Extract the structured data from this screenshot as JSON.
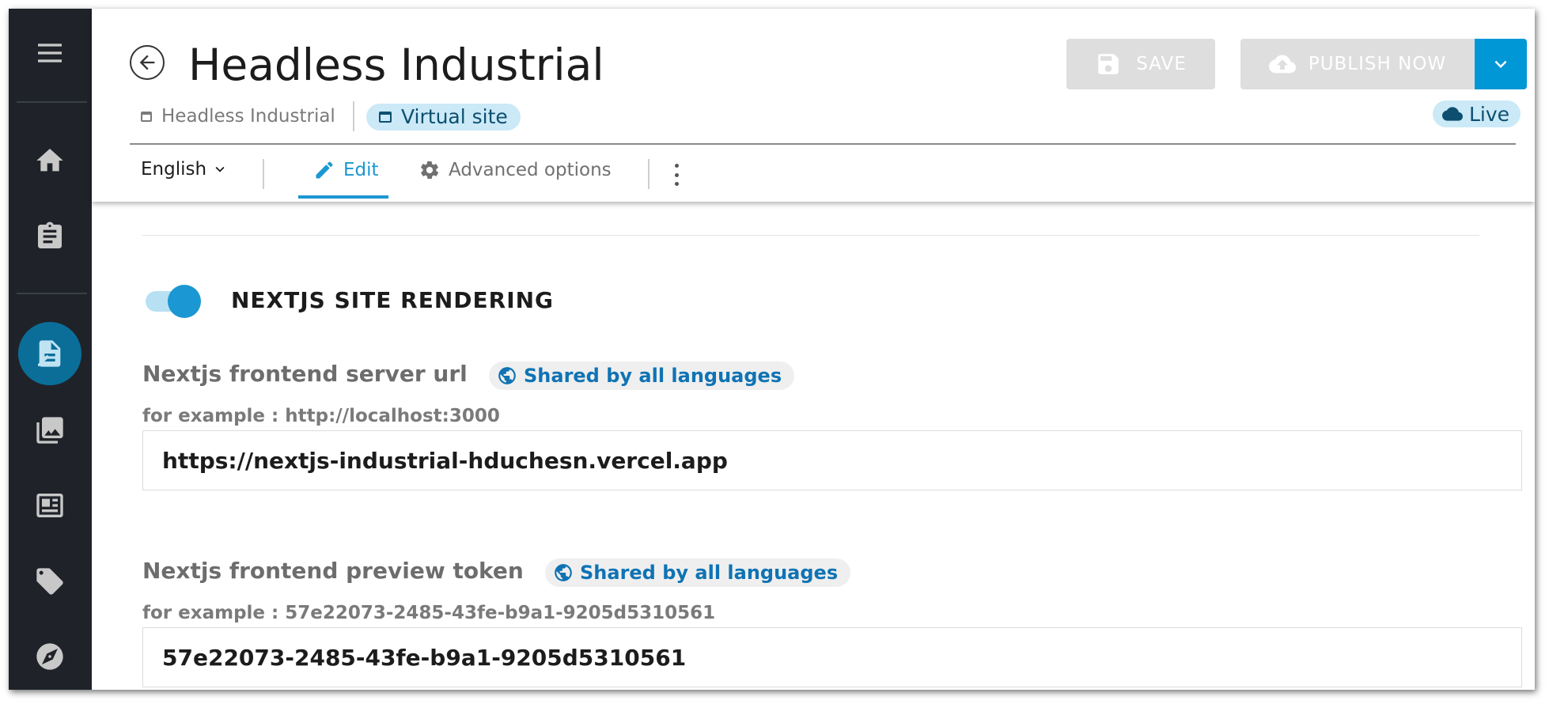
{
  "header": {
    "title": "Headless Industrial",
    "breadcrumb_site": "Headless Industrial",
    "breadcrumb_virtual": "Virtual site",
    "save_label": "SAVE",
    "publish_label": "PUBLISH NOW",
    "status_label": "Live"
  },
  "toolbar": {
    "language": "English",
    "tabs": [
      {
        "label": "Edit",
        "active": true
      },
      {
        "label": "Advanced options",
        "active": false
      }
    ]
  },
  "sidebar": {
    "items": [
      {
        "icon": "menu-icon"
      },
      {
        "icon": "home-icon"
      },
      {
        "icon": "clipboard-icon"
      },
      {
        "icon": "page-edit-icon",
        "active": true
      },
      {
        "icon": "images-icon"
      },
      {
        "icon": "newspaper-icon"
      },
      {
        "icon": "tag-icon"
      },
      {
        "icon": "compass-icon"
      }
    ]
  },
  "form": {
    "toggle": {
      "label": "NEXTJS SITE RENDERING",
      "on": true
    },
    "fields": [
      {
        "label": "Nextjs frontend server url",
        "shared": "Shared by all languages",
        "hint": "for example : http://localhost:3000",
        "value": "https://nextjs-industrial-hduchesn.vercel.app"
      },
      {
        "label": "Nextjs frontend preview token",
        "shared": "Shared by all languages",
        "hint": "for example : 57e22073-2485-43fe-b9a1-9205d5310561",
        "value": "57e22073-2485-43fe-b9a1-9205d5310561"
      }
    ]
  },
  "colors": {
    "accent": "#1b97d3",
    "publish_dropdown": "#0097d7",
    "rail": "#1f2329",
    "active_rail": "#0b6e99",
    "badge_bg": "#cbe9f7",
    "disabled_button": "#dedede"
  }
}
